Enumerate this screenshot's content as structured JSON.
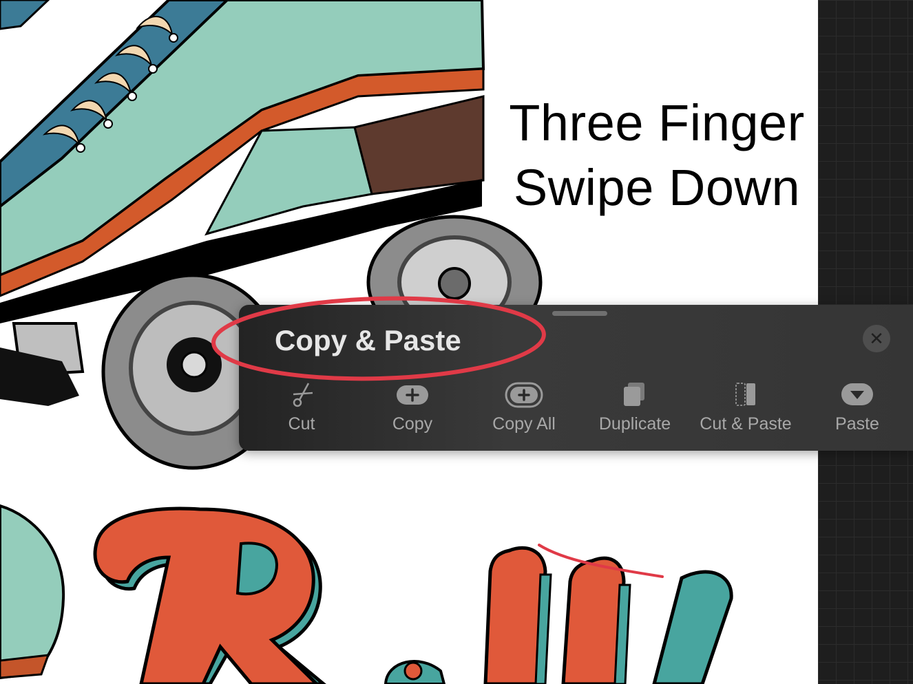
{
  "instruction": {
    "line1": "Three Finger",
    "line2": "Swipe Down"
  },
  "panel": {
    "title": "Copy & Paste",
    "close_icon": "close-icon",
    "actions": [
      {
        "label": "Cut",
        "icon": "scissors-icon"
      },
      {
        "label": "Copy",
        "icon": "copy-plus-icon"
      },
      {
        "label": "Copy All",
        "icon": "copy-all-icon"
      },
      {
        "label": "Duplicate",
        "icon": "duplicate-icon"
      },
      {
        "label": "Cut & Paste",
        "icon": "cut-paste-icon"
      },
      {
        "label": "Paste",
        "icon": "paste-icon"
      }
    ]
  },
  "colors": {
    "panel_bg": "#353535",
    "highlight": "#e03a47",
    "skate_mint": "#94cdbb",
    "skate_blue": "#3c7b96",
    "skate_brown": "#5e3a2e",
    "lettering_orange": "#e0593a",
    "lettering_teal": "#48a59f"
  }
}
